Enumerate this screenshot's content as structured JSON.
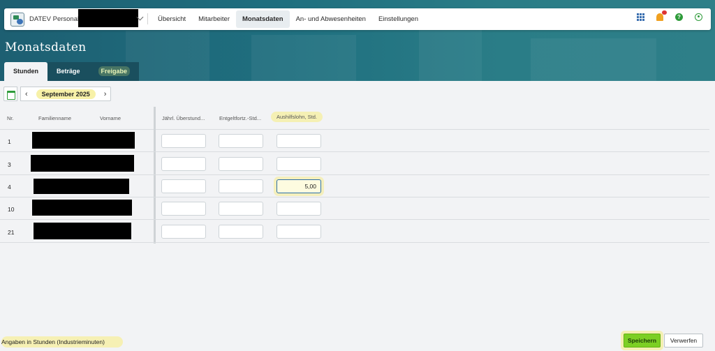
{
  "app": {
    "name": "DATEV Personal"
  },
  "nav": {
    "items": [
      {
        "label": "Übersicht",
        "active": false
      },
      {
        "label": "Mitarbeiter",
        "active": false
      },
      {
        "label": "Monatsdaten",
        "active": true
      },
      {
        "label": "An- und Abwesenheiten",
        "active": false
      },
      {
        "label": "Einstellungen",
        "active": false
      }
    ],
    "icons": [
      "apps-grid-icon",
      "notification-bell-icon",
      "help-icon",
      "user-account-icon"
    ]
  },
  "page": {
    "title": "Monatsdaten"
  },
  "tabs": [
    {
      "label": "Stunden",
      "active": true
    },
    {
      "label": "Beträge",
      "active": false
    },
    {
      "label": "Freigabe",
      "active": false
    }
  ],
  "month": {
    "label": "September 2025",
    "prev": "‹",
    "next": "›"
  },
  "table": {
    "headers": {
      "nr": "Nr.",
      "familienname": "Familienname",
      "vorname": "Vorname",
      "col1": "Jährl. Überstund...",
      "col2": "Entgeltfortz.-Std...",
      "col3": "Aushilfslohn, Std."
    },
    "rows": [
      {
        "nr": "1",
        "col1": "",
        "col2": "",
        "col3": ""
      },
      {
        "nr": "3",
        "col1": "",
        "col2": "",
        "col3": ""
      },
      {
        "nr": "4",
        "col1": "",
        "col2": "",
        "col3": "5,00"
      },
      {
        "nr": "10",
        "col1": "",
        "col2": "",
        "col3": ""
      },
      {
        "nr": "21",
        "col1": "",
        "col2": "",
        "col3": ""
      }
    ]
  },
  "footer": {
    "note": "Angaben in Stunden (Industrieminuten)",
    "save": "Speichern",
    "discard": "Verwerfen"
  },
  "colors": {
    "header_bg": "#1f6f7f",
    "save_green": "#7ccf24",
    "highlight_yellow": "#f5f0b4"
  }
}
